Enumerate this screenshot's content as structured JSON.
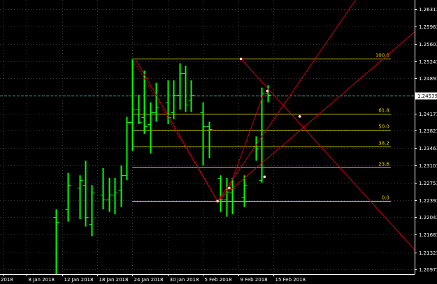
{
  "chart_data": {
    "type": "bar",
    "subtype": "ohlc",
    "title": "",
    "xlabel": "",
    "ylabel": "",
    "ylim": [
      1.2087,
      1.265
    ],
    "grid": true,
    "colors": {
      "background": "#000000",
      "bars": "#00ff00",
      "grid": "#3a3a3a",
      "fib": "#d4c800",
      "fib_text": "#e6d800",
      "fan": "#c8000f",
      "bid_line": "#5fb8a8",
      "axis_text": "#ffffff",
      "price_box": "#ffffff"
    },
    "y_ticks": [
      "1.26311",
      "1.25961",
      "1.25601",
      "1.25241",
      "1.24891",
      "1.24171",
      "1.23821",
      "1.23461",
      "1.23101",
      "1.22751",
      "1.22391",
      "1.22041",
      "1.21681",
      "1.21321",
      "1.20971"
    ],
    "y_tick_values": [
      1.26311,
      1.25961,
      1.25601,
      1.25241,
      1.24891,
      1.24171,
      1.23821,
      1.23461,
      1.23101,
      1.22751,
      1.22391,
      1.22041,
      1.21681,
      1.21321,
      1.20971
    ],
    "x_tick_labels": [
      {
        "label": "2018",
        "index": 0
      },
      {
        "label": "8 Jan 2018",
        "index": 4
      },
      {
        "label": "12 Jan 2018",
        "index": 10
      },
      {
        "label": "18 Jan 2018",
        "index": 16
      },
      {
        "label": "24 Jan 2018",
        "index": 22
      },
      {
        "label": "30 Jan 2018",
        "index": 28
      },
      {
        "label": "5 Feb 2018",
        "index": 34
      },
      {
        "label": "9 Feb 2018",
        "index": 40
      },
      {
        "label": "15 Feb 2018",
        "index": 46
      }
    ],
    "bars": [
      {
        "i": 9,
        "o": 1.2205,
        "h": 1.222,
        "l": 1.2087,
        "c": 1.2195
      },
      {
        "i": 11,
        "o": 1.222,
        "h": 1.2295,
        "l": 1.2195,
        "c": 1.227
      },
      {
        "i": 13,
        "o": 1.2265,
        "h": 1.229,
        "l": 1.22,
        "c": 1.228
      },
      {
        "i": 14,
        "o": 1.227,
        "h": 1.232,
        "l": 1.2185,
        "c": 1.2205
      },
      {
        "i": 15,
        "o": 1.219,
        "h": 1.227,
        "l": 1.2165,
        "c": 1.2255
      },
      {
        "i": 17,
        "o": 1.225,
        "h": 1.2305,
        "l": 1.222,
        "c": 1.224
      },
      {
        "i": 18,
        "o": 1.224,
        "h": 1.2285,
        "l": 1.2215,
        "c": 1.225
      },
      {
        "i": 19,
        "o": 1.225,
        "h": 1.2285,
        "l": 1.221,
        "c": 1.2255
      },
      {
        "i": 20,
        "o": 1.226,
        "h": 1.231,
        "l": 1.2225,
        "c": 1.229
      },
      {
        "i": 21,
        "o": 1.229,
        "h": 1.241,
        "l": 1.228,
        "c": 1.24
      },
      {
        "i": 22,
        "o": 1.24,
        "h": 1.253,
        "l": 1.234,
        "c": 1.2425
      },
      {
        "i": 23,
        "o": 1.2425,
        "h": 1.2455,
        "l": 1.2395,
        "c": 1.24
      },
      {
        "i": 24,
        "o": 1.241,
        "h": 1.2505,
        "l": 1.2375,
        "c": 1.239
      },
      {
        "i": 25,
        "o": 1.2395,
        "h": 1.244,
        "l": 1.2335,
        "c": 1.242
      },
      {
        "i": 26,
        "o": 1.242,
        "h": 1.248,
        "l": 1.24,
        "c": 1.243
      },
      {
        "i": 28,
        "o": 1.244,
        "h": 1.2485,
        "l": 1.2395,
        "c": 1.241
      },
      {
        "i": 29,
        "o": 1.242,
        "h": 1.2485,
        "l": 1.2405,
        "c": 1.2455
      },
      {
        "i": 30,
        "o": 1.2455,
        "h": 1.252,
        "l": 1.2425,
        "c": 1.25
      },
      {
        "i": 31,
        "o": 1.25,
        "h": 1.2515,
        "l": 1.242,
        "c": 1.2435
      },
      {
        "i": 32,
        "o": 1.2445,
        "h": 1.2485,
        "l": 1.242,
        "c": 1.2455
      },
      {
        "i": 34,
        "o": 1.242,
        "h": 1.244,
        "l": 1.231,
        "c": 1.239
      },
      {
        "i": 35,
        "o": 1.239,
        "h": 1.24,
        "l": 1.2325,
        "c": 1.2385
      },
      {
        "i": 37,
        "o": 1.2285,
        "h": 1.229,
        "l": 1.2215,
        "c": 1.224
      },
      {
        "i": 38,
        "o": 1.224,
        "h": 1.2285,
        "l": 1.2205,
        "c": 1.2255
      },
      {
        "i": 39,
        "o": 1.2255,
        "h": 1.2285,
        "l": 1.221,
        "c": 1.2265
      },
      {
        "i": 41,
        "o": 1.2245,
        "h": 1.229,
        "l": 1.2225,
        "c": 1.227
      },
      {
        "i": 43,
        "o": 1.235,
        "h": 1.237,
        "l": 1.232,
        "c": 1.2345
      },
      {
        "i": 44,
        "o": 1.228,
        "h": 1.247,
        "l": 1.2275,
        "c": 1.246
      },
      {
        "i": 45,
        "o": 1.246,
        "h": 1.2475,
        "l": 1.244,
        "c": 1.2455
      }
    ],
    "fibonacci": {
      "start_index": 22,
      "end_index": 66,
      "levels": [
        {
          "label": "100.0",
          "price": 1.2529
        },
        {
          "label": "61.8",
          "price": 1.2417
        },
        {
          "label": "50.0",
          "price": 1.2383
        },
        {
          "label": "38.2",
          "price": 1.2349
        },
        {
          "label": "23.6",
          "price": 1.2306
        },
        {
          "label": "0.0",
          "price": 1.2237
        }
      ]
    },
    "fan_lines": [
      {
        "from": {
          "i": 36.5,
          "p": 1.2237
        },
        "to": {
          "i": 60,
          "p": 1.265
        }
      },
      {
        "from": {
          "i": 36.5,
          "p": 1.2237
        },
        "to": {
          "i": 73,
          "p": 1.2615
        }
      },
      {
        "from": {
          "i": 40.5,
          "p": 1.2529
        },
        "to": {
          "i": 73,
          "p": 1.2098
        }
      },
      {
        "from": {
          "i": 22.5,
          "p": 1.2529
        },
        "to": {
          "i": 36.5,
          "p": 1.2237
        }
      },
      {
        "from": {
          "i": 38.5,
          "p": 1.2264
        },
        "to": {
          "i": 44.5,
          "p": 1.2463
        }
      },
      {
        "from": {
          "i": 36.5,
          "p": 1.2237
        },
        "to": {
          "i": 38.5,
          "p": 1.2264
        }
      }
    ],
    "markers": [
      {
        "i": 40.5,
        "p": 1.2529
      },
      {
        "i": 45,
        "p": 1.2463
      },
      {
        "i": 50.5,
        "p": 1.2411
      },
      {
        "i": 36.5,
        "p": 1.2237
      },
      {
        "i": 38.5,
        "p": 1.2264
      },
      {
        "i": 44.5,
        "p": 1.2287
      }
    ],
    "bid_line": {
      "price": 1.24539,
      "label": "1.24539"
    }
  }
}
